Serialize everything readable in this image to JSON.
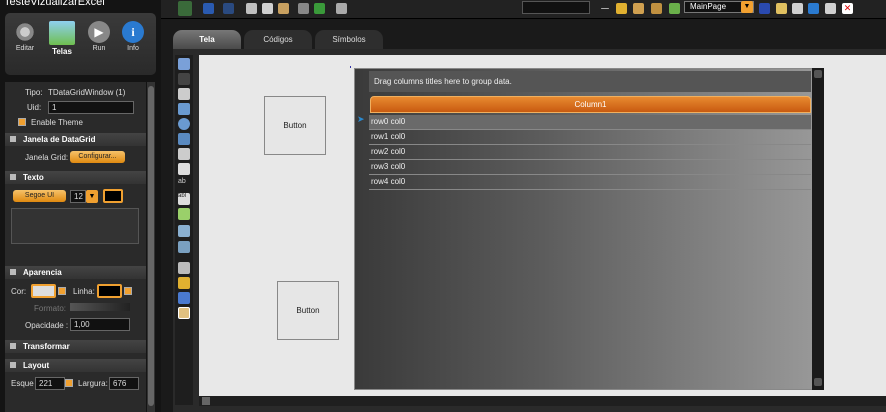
{
  "app_title": "TesteVizualizarExcel",
  "ribbon": [
    {
      "label": "Editar"
    },
    {
      "label": "Telas"
    },
    {
      "label": "Run"
    },
    {
      "label": "Info"
    }
  ],
  "props": {
    "tipo_label": "Tipo:",
    "tipo_value": "TDataGridWindow (1)",
    "uid_label": "Uid:",
    "uid_value": "1",
    "enable_theme": "Enable Theme",
    "janela_section": "Janela de DataGrid",
    "janela_grid_label": "Janela Grid:",
    "configurar": "Configurar...",
    "texto_section": "Texto",
    "font_name": "Segoe UI",
    "font_size": "12",
    "aparencia_section": "Aparencia",
    "cor_label": "Cor:",
    "linha_label": "Linha:",
    "formato_label": "Formato:",
    "opacidade_label": "Opacidade :",
    "opacidade_value": "1,00",
    "transformar_section": "Transformar",
    "layout_section": "Layout",
    "esque_label": "Esque",
    "esque_value": "221",
    "largura_label": "Largura:",
    "largura_value": "676"
  },
  "toolbar": {
    "page_select": "MainPage"
  },
  "tabs": [
    {
      "label": "Tela"
    },
    {
      "label": "Códigos"
    },
    {
      "label": "Símbolos"
    }
  ],
  "canvas": {
    "button1": "Button",
    "button2": "Button",
    "grid": {
      "group_hint": "Drag columns titles here to group data.",
      "column": "Column1",
      "rows": [
        "row0 col0",
        "row1 col0",
        "row2 col0",
        "row3 col0",
        "row4 col0"
      ]
    }
  },
  "colors": {
    "accent": "#f0a030",
    "header": "#d06a18"
  }
}
